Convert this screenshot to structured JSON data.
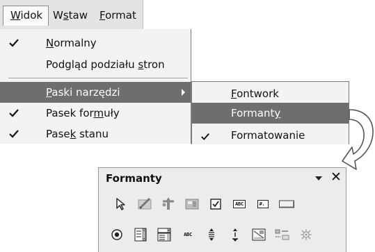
{
  "menubar": {
    "items": [
      {
        "label": "Widok",
        "mnemonic": "W"
      },
      {
        "label": "Wstaw",
        "mnemonic": "s"
      },
      {
        "label": "Format",
        "mnemonic": "F"
      }
    ]
  },
  "view_menu": {
    "items": [
      {
        "label": "Normalny",
        "checked": true
      },
      {
        "label": "Podgląd podziału stron",
        "checked": false
      },
      {
        "label": "Paski narzędzi",
        "checked": false,
        "submenu": true,
        "highlighted": true
      },
      {
        "label": "Pasek formuły",
        "checked": true
      },
      {
        "label": "Pasek stanu",
        "checked": true
      }
    ]
  },
  "toolbars_submenu": {
    "items": [
      {
        "label": "Fontwork",
        "checked": false
      },
      {
        "label": "Formanty",
        "checked": false,
        "highlighted": true
      },
      {
        "label": "Formatowanie",
        "checked": true
      }
    ]
  },
  "form_controls_toolbar": {
    "title": "Formanty",
    "row1_icons": [
      "select-pointer-icon",
      "design-mode-icon",
      "control-wizards-icon",
      "form-design-icon",
      "checkbox-icon",
      "text-box-icon",
      "formatted-field-icon",
      "push-button-icon"
    ],
    "row2_icons": [
      "option-button-icon",
      "list-box-icon",
      "combo-box-icon",
      "label-field-icon",
      "numerical-field-icon",
      "spin-button-icon",
      "image-control-icon",
      "more-controls-icon",
      "form-navigator-icon"
    ],
    "labels": {
      "abc": "ABC",
      "hash": "#.",
      "abc_small": "ABC"
    }
  },
  "colors": {
    "highlight": "#6e6e6e",
    "menu_bg": "#f3f3f3",
    "toolbar_bg": "#ececec"
  }
}
